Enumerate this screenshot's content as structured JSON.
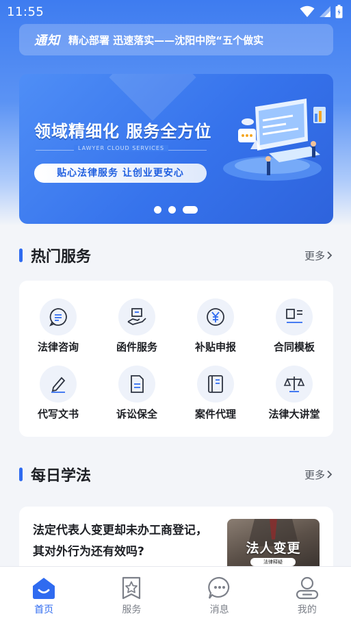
{
  "status_bar": {
    "time": "11:55"
  },
  "notice": {
    "tag": "通知",
    "text": "精心部署 迅速落实——沈阳中院“五个做实"
  },
  "banner": {
    "title": "领域精细化  服务全方位",
    "subtitle": "LAWYER CLOUD SERVICES",
    "slogan": "贴心法律服务  让创业更安心",
    "page_count": 3,
    "active_page": 3
  },
  "hot_services": {
    "title": "热门服务",
    "more": "更多",
    "items": [
      {
        "label": "法律咨询",
        "icon": "chat-bubble-icon"
      },
      {
        "label": "函件服务",
        "icon": "letter-hand-icon"
      },
      {
        "label": "补贴申报",
        "icon": "yuan-coin-icon"
      },
      {
        "label": "合同模板",
        "icon": "template-grid-icon"
      },
      {
        "label": "代写文书",
        "icon": "pen-edit-icon"
      },
      {
        "label": "诉讼保全",
        "icon": "document-icon"
      },
      {
        "label": "案件代理",
        "icon": "case-book-icon"
      },
      {
        "label": "法律大讲堂",
        "icon": "balance-scale-icon"
      }
    ]
  },
  "daily_study": {
    "title": "每日学法",
    "more": "更多",
    "article": {
      "title": "法定代表人变更却未办工商登记，其对外行为还有效吗?",
      "thumb_text": "法人变更",
      "thumb_tag": "法律释疑"
    }
  },
  "tabbar": {
    "items": [
      {
        "label": "首页",
        "icon": "home-icon",
        "active": true
      },
      {
        "label": "服务",
        "icon": "service-star-icon",
        "active": false
      },
      {
        "label": "消息",
        "icon": "message-icon",
        "active": false
      },
      {
        "label": "我的",
        "icon": "profile-icon",
        "active": false
      }
    ]
  },
  "colors": {
    "accent": "#2f6bf0",
    "header_gradient_top": "#3e7cf0",
    "background": "#f3f5f9",
    "tab_inactive": "#7c8089"
  }
}
